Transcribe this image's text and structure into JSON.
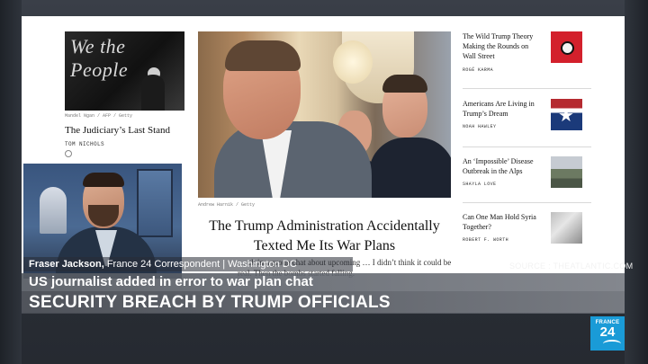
{
  "webpage": {
    "left_story": {
      "image_text": "We the People",
      "credit": "Mandel Ngan / AFP / Getty",
      "title": "The Judiciary’s Last Stand",
      "author": "TOM NICHOLS"
    },
    "main_story": {
      "credit": "Andrew Harnik / Getty",
      "title": "The Trump Administration Accidentally Texted Me Its War Plans",
      "dek": "…  ck in a group chat about upcoming  …  I didn’t think it could be real. Then the bombs started falling."
    },
    "rail": [
      {
        "title": "The Wild Trump Theory Making the Rounds on Wall Street",
        "author": "ROGÉ KARMA",
        "thumb": "red-eye-icon"
      },
      {
        "title": "Americans Are Living in Trump’s Dream",
        "author": "NOAH HAWLEY",
        "thumb": "flag-star-icon"
      },
      {
        "title": "An ‘Impossible’ Disease Outbreak in the Alps",
        "author": "SHAYLA LOVE",
        "thumb": "alps-photo"
      },
      {
        "title": "Can One Man Hold Syria Together?",
        "author": "ROBERT F. WORTH",
        "thumb": "syria-photo"
      }
    ]
  },
  "broadcast": {
    "name_strip": {
      "name": "Fraser Jackson,",
      "role": " France 24 Correspondent | Washington DC"
    },
    "source": "SOURCE : THEATLANTIC.COM",
    "headline_sub": "US journalist added in error to war plan chat",
    "headline_main": "SECURITY BREACH BY TRUMP OFFICIALS",
    "logo_top": "FRANCE",
    "logo_bottom": "24"
  },
  "colors": {
    "logo_blue": "#1a9bd7",
    "lower_third": "#555a62"
  }
}
